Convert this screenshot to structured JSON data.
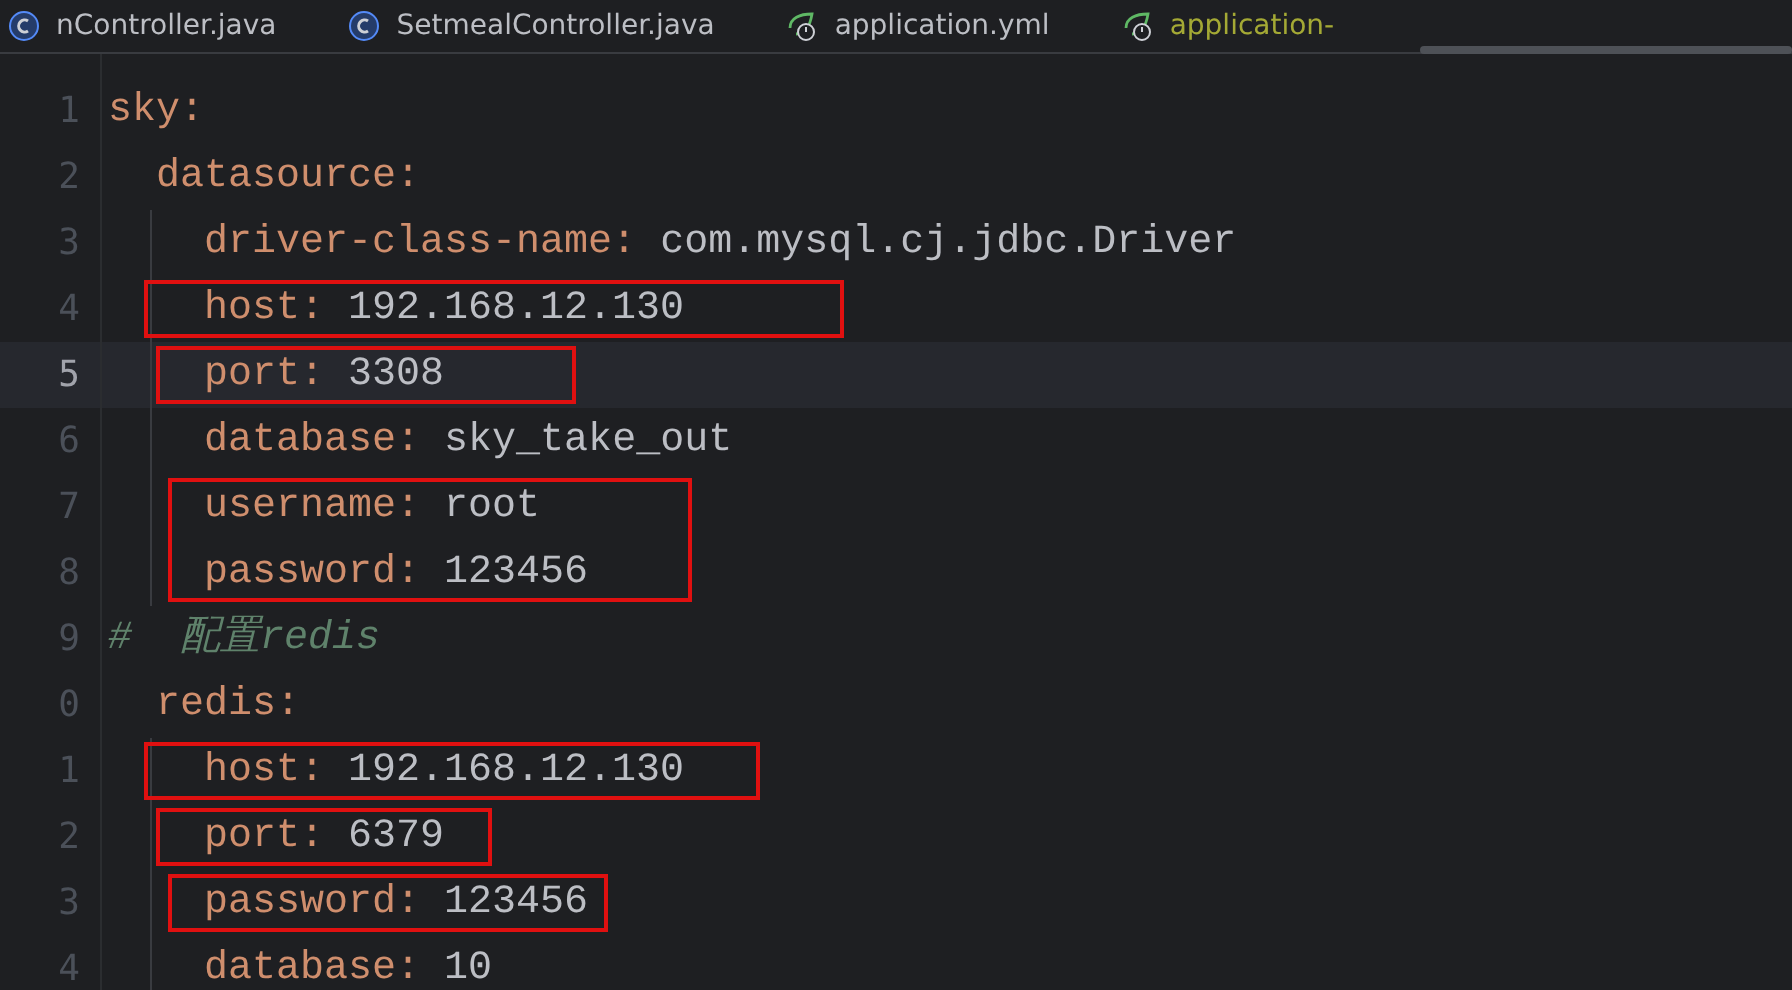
{
  "tabs": [
    {
      "label": "nController.java",
      "kind": "java",
      "selected": false
    },
    {
      "label": "SetmealController.java",
      "kind": "java",
      "selected": false
    },
    {
      "label": "application.yml",
      "kind": "yaml",
      "selected": false
    },
    {
      "label": "application-",
      "kind": "yaml",
      "selected": true
    }
  ],
  "editor": {
    "lines": [
      {
        "number": "1",
        "key": "sky:",
        "current": false,
        "boxed": false,
        "children": [
          {
            "number": "2",
            "key": "datasource:",
            "current": false,
            "boxed": false,
            "children": [
              {
                "number": "3",
                "key": "driver-class-name:",
                "value": "com.mysql.cj.jdbc.Driver",
                "current": false,
                "boxed": false
              },
              {
                "number": "4",
                "key": "host:",
                "value": "192.168.12.130",
                "current": false,
                "boxed": true
              },
              {
                "number": "5",
                "key": "port:",
                "value": "3308",
                "current": true,
                "boxed": true
              },
              {
                "number": "6",
                "key": "database:",
                "value": "sky_take_out",
                "current": false,
                "boxed": false
              },
              {
                "number": "7",
                "key": "username:",
                "value": "root",
                "current": false,
                "boxed": true,
                "box_continues": true
              },
              {
                "number": "8",
                "key": "password:",
                "value": "123456",
                "current": false,
                "boxed": true
              }
            ]
          },
          {
            "number": "9",
            "kind": "comment",
            "text": "#  配置redis",
            "current": false,
            "boxed": false
          },
          {
            "number": "0",
            "key": "redis:",
            "current": false,
            "boxed": false,
            "children": [
              {
                "number": "1",
                "key": "host:",
                "value": "192.168.12.130",
                "current": false,
                "boxed": true
              },
              {
                "number": "2",
                "key": "port:",
                "value": "6379",
                "current": false,
                "boxed": true
              },
              {
                "number": "3",
                "key": "password:",
                "value": "123456",
                "current": false,
                "boxed": true
              },
              {
                "number": "4",
                "key": "database:",
                "value": "10",
                "current": false,
                "boxed": false
              }
            ]
          }
        ]
      }
    ]
  }
}
